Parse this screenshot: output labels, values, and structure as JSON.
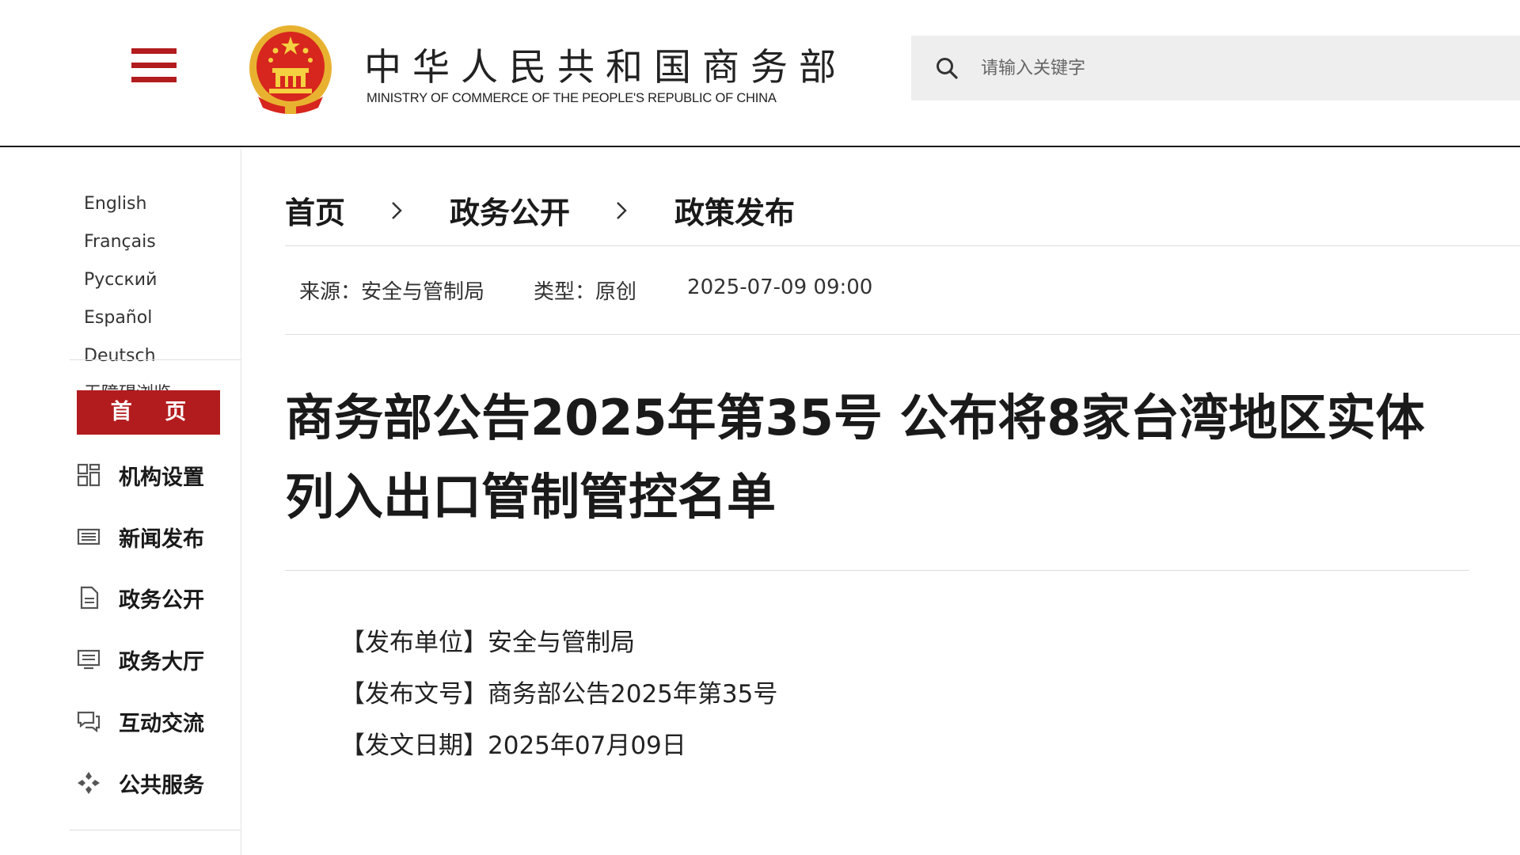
{
  "header": {
    "site_title_cn": "中华人民共和国商务部",
    "site_title_en": "MINISTRY OF COMMERCE OF THE PEOPLE'S REPUBLIC OF CHINA",
    "search_placeholder": "请输入关键字",
    "brand_color": "#b31c1e"
  },
  "sidebar": {
    "languages": [
      "English",
      "Français",
      "Русский",
      "Español",
      "Deutsch"
    ],
    "accessibility_label": "无障碍浏览",
    "home_label": "首 页",
    "nav_items": [
      {
        "label": "机构设置",
        "icon": "org-grid-icon"
      },
      {
        "label": "新闻发布",
        "icon": "news-icon"
      },
      {
        "label": "政务公开",
        "icon": "document-icon"
      },
      {
        "label": "政务大厅",
        "icon": "monitor-icon"
      },
      {
        "label": "互动交流",
        "icon": "chat-icon"
      },
      {
        "label": "公共服务",
        "icon": "service-icon"
      }
    ]
  },
  "breadcrumb": [
    "首页",
    "政务公开",
    "政策发布"
  ],
  "meta": {
    "source": "来源：安全与管制局",
    "type": "类型：原创",
    "datetime": "2025-07-09 09:00"
  },
  "article": {
    "title_line1": "商务部公告2025年第35号 公布将8家台湾地区实体",
    "title_line2": "列入出口管制管控名单",
    "info": [
      "【发布单位】安全与管制局",
      "【发布文号】商务部公告2025年第35号",
      "【发文日期】2025年07月09日"
    ]
  }
}
